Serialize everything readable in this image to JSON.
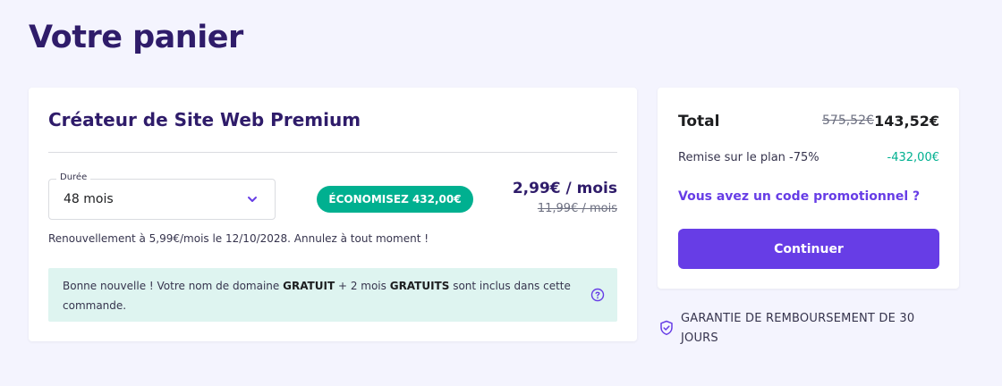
{
  "page": {
    "title": "Votre panier"
  },
  "product": {
    "title": "Créateur de Site Web Premium",
    "duration": {
      "legend": "Durée",
      "selected": "48 mois",
      "icon": "chevron-down-icon"
    },
    "savings_badge": "ÉCONOMISEZ 432,00€",
    "price_now": "2,99€ / mois",
    "price_old": "11,99€ / mois",
    "renewal": "Renouvellement à 5,99€/mois le 12/10/2028. Annulez à tout moment !",
    "notice": {
      "part1": "Bonne nouvelle ! Votre nom de domaine ",
      "bold1": "GRATUIT",
      "part2": " + 2 mois ",
      "bold2": "GRATUITS",
      "part3": " sont inclus dans cette commande.",
      "icon": "help-icon"
    }
  },
  "summary": {
    "total_label": "Total",
    "total_old": "575,52€",
    "total_new": "143,52€",
    "discount_label": "Remise sur le plan -75%",
    "discount_value": "-432,00€",
    "promo_link": "Vous avez un code promotionnel ?",
    "continue_label": "Continuer"
  },
  "guarantee": {
    "text": "GARANTIE DE REMBOURSEMENT DE 30 JOURS",
    "icon": "shield-check-icon"
  },
  "colors": {
    "primary": "#673de6",
    "heading": "#2f1c6a",
    "success": "#00b090",
    "notice_bg": "#def4f0",
    "page_bg": "#f4f4fe"
  }
}
